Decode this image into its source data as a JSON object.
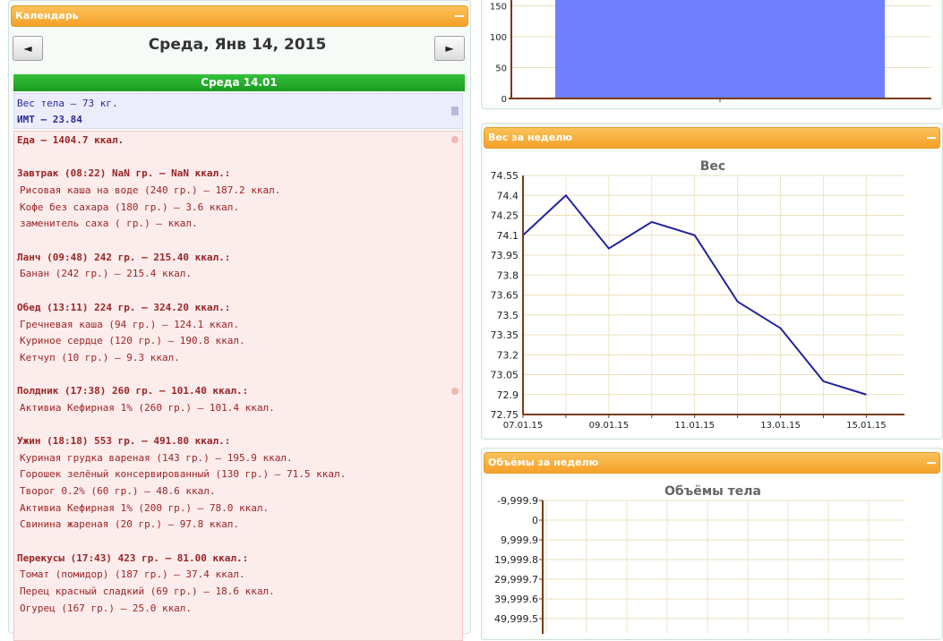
{
  "calendar": {
    "panel_title": "Календарь",
    "prev_label": "◄",
    "next_label": "►",
    "date_title": "Среда, Янв 14, 2015",
    "day_bar": "Среда 14.01"
  },
  "stats": {
    "weight": "Вес тела — 73 кг.",
    "bmi": "ИМТ — 23.84"
  },
  "food": {
    "total": "Еда — 1404.7 ккал.",
    "meals": [
      {
        "title": "Завтрак (08:22) NaN гр. — NaN ккал.:",
        "items": [
          "Рисовая каша на воде (240 гр.) — 187.2 ккал.",
          "Кофе без сахара (180 гр.) — 3.6 ккал.",
          "заменитель саха ( гр.) — ккал."
        ]
      },
      {
        "title": "Ланч (09:48) 242 гр. — 215.40 ккал.:",
        "items": [
          "Банан (242 гр.) — 215.4 ккал."
        ]
      },
      {
        "title": "Обед (13:11) 224 гр. — 324.20 ккал.:",
        "items": [
          "Гречневая каша (94 гр.) — 124.1 ккал.",
          "Куриное сердце (120 гр.) — 190.8 ккал.",
          "Кетчуп (10 гр.) — 9.3 ккал."
        ]
      },
      {
        "title": "Полдник (17:38) 260 гр. — 101.40 ккал.:",
        "items": [
          "Активиа Кефирная 1% (260 гр.) — 101.4 ккал."
        ]
      },
      {
        "title": "Ужин (18:18) 553 гр. — 491.80 ккал.:",
        "items": [
          "Куриная грудка вареная (143 гр.) — 195.9 ккал.",
          "Горошек зелёный консервированный (130 гр.) — 71.5 ккал.",
          "Творог 0.2% (60 гр.) — 48.6 ккал.",
          "Активиа Кефирная 1% (200 гр.) — 78.0 ккал.",
          "Свинина жареная (20 гр.) — 97.8 ккал."
        ]
      },
      {
        "title": "Перекусы (17:43) 423 гр. — 81.00 ккал.:",
        "items": [
          "Томат (помидор) (187 гр.) — 37.4 ккал.",
          "Перец красный сладкий (69 гр.) — 18.6 ккал.",
          "Огурец (167 гр.) — 25.0 ккал."
        ]
      }
    ]
  },
  "weight_panel": {
    "title": "Вес за неделю"
  },
  "volume_panel": {
    "title": "Объёмы за неделю"
  },
  "colors": {
    "header": "#f4a128",
    "line": "#2222a0",
    "bar": "#7080ff",
    "axis": "#7a3a1a",
    "grid": "#e8e0b8"
  },
  "chart_data": [
    {
      "type": "bar",
      "ylim": [
        0,
        150
      ],
      "yticks": [
        "0",
        "50",
        "100",
        "150"
      ],
      "values": [
        150
      ]
    },
    {
      "type": "line",
      "title": "Вес",
      "x": [
        "07.01.15",
        "08.01.15",
        "09.01.15",
        "10.01.15",
        "11.01.15",
        "12.01.15",
        "13.01.15",
        "14.01.15",
        "15.01.15"
      ],
      "xtick_labels": [
        "07.01.15",
        "09.01.15",
        "11.01.15",
        "13.01.15",
        "15.01.15"
      ],
      "values": [
        74.1,
        74.4,
        74.0,
        74.2,
        74.1,
        73.6,
        73.4,
        73.0,
        72.9
      ],
      "ylim": [
        72.75,
        74.55
      ],
      "yticks": [
        "74.55",
        "74.4",
        "74.25",
        "74.1",
        "73.95",
        "73.8",
        "73.65",
        "73.5",
        "73.35",
        "73.2",
        "73.05",
        "72.9",
        "72.75"
      ]
    },
    {
      "type": "line",
      "title": "Объёмы тела",
      "yticks": [
        "-9,999.9",
        "0",
        "9,999.9",
        "19,999.8",
        "29,999.7",
        "39,999.6",
        "49,999.5"
      ]
    }
  ]
}
